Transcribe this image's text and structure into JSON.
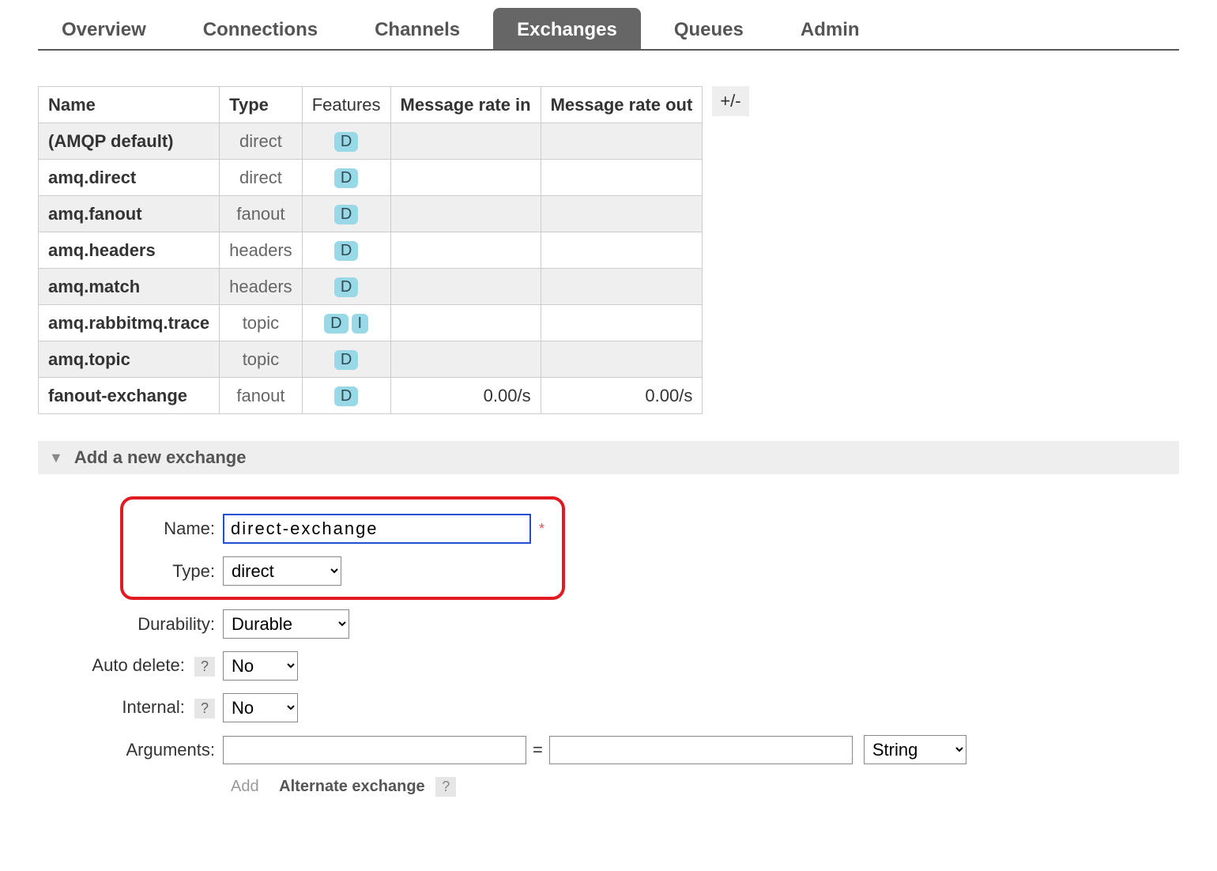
{
  "tabs": {
    "overview": "Overview",
    "connections": "Connections",
    "channels": "Channels",
    "exchanges": "Exchanges",
    "queues": "Queues",
    "admin": "Admin",
    "active": "exchanges"
  },
  "table": {
    "columns": {
      "name": "Name",
      "type": "Type",
      "features": "Features",
      "rate_in": "Message rate in",
      "rate_out": "Message rate out"
    },
    "rows": [
      {
        "name": "(AMQP default)",
        "type": "direct",
        "features": [
          "D"
        ],
        "rate_in": "",
        "rate_out": ""
      },
      {
        "name": "amq.direct",
        "type": "direct",
        "features": [
          "D"
        ],
        "rate_in": "",
        "rate_out": ""
      },
      {
        "name": "amq.fanout",
        "type": "fanout",
        "features": [
          "D"
        ],
        "rate_in": "",
        "rate_out": ""
      },
      {
        "name": "amq.headers",
        "type": "headers",
        "features": [
          "D"
        ],
        "rate_in": "",
        "rate_out": ""
      },
      {
        "name": "amq.match",
        "type": "headers",
        "features": [
          "D"
        ],
        "rate_in": "",
        "rate_out": ""
      },
      {
        "name": "amq.rabbitmq.trace",
        "type": "topic",
        "features": [
          "D",
          "I"
        ],
        "rate_in": "",
        "rate_out": ""
      },
      {
        "name": "amq.topic",
        "type": "topic",
        "features": [
          "D"
        ],
        "rate_in": "",
        "rate_out": ""
      },
      {
        "name": "fanout-exchange",
        "type": "fanout",
        "features": [
          "D"
        ],
        "rate_in": "0.00/s",
        "rate_out": "0.00/s"
      }
    ],
    "column_control": "+/-"
  },
  "add_exchange": {
    "header": "Add a new exchange",
    "labels": {
      "name": "Name:",
      "type": "Type:",
      "durability": "Durability:",
      "auto_delete": "Auto delete:",
      "internal": "Internal:",
      "arguments": "Arguments:"
    },
    "values": {
      "name": "direct-exchange",
      "type": "direct",
      "durability": "Durable",
      "auto_delete": "No",
      "internal": "No",
      "arg_key": "",
      "arg_val": "",
      "arg_type": "String"
    },
    "required_marker": "*",
    "help_marker": "?",
    "hint": {
      "add": "Add",
      "alternate": "Alternate exchange"
    }
  }
}
